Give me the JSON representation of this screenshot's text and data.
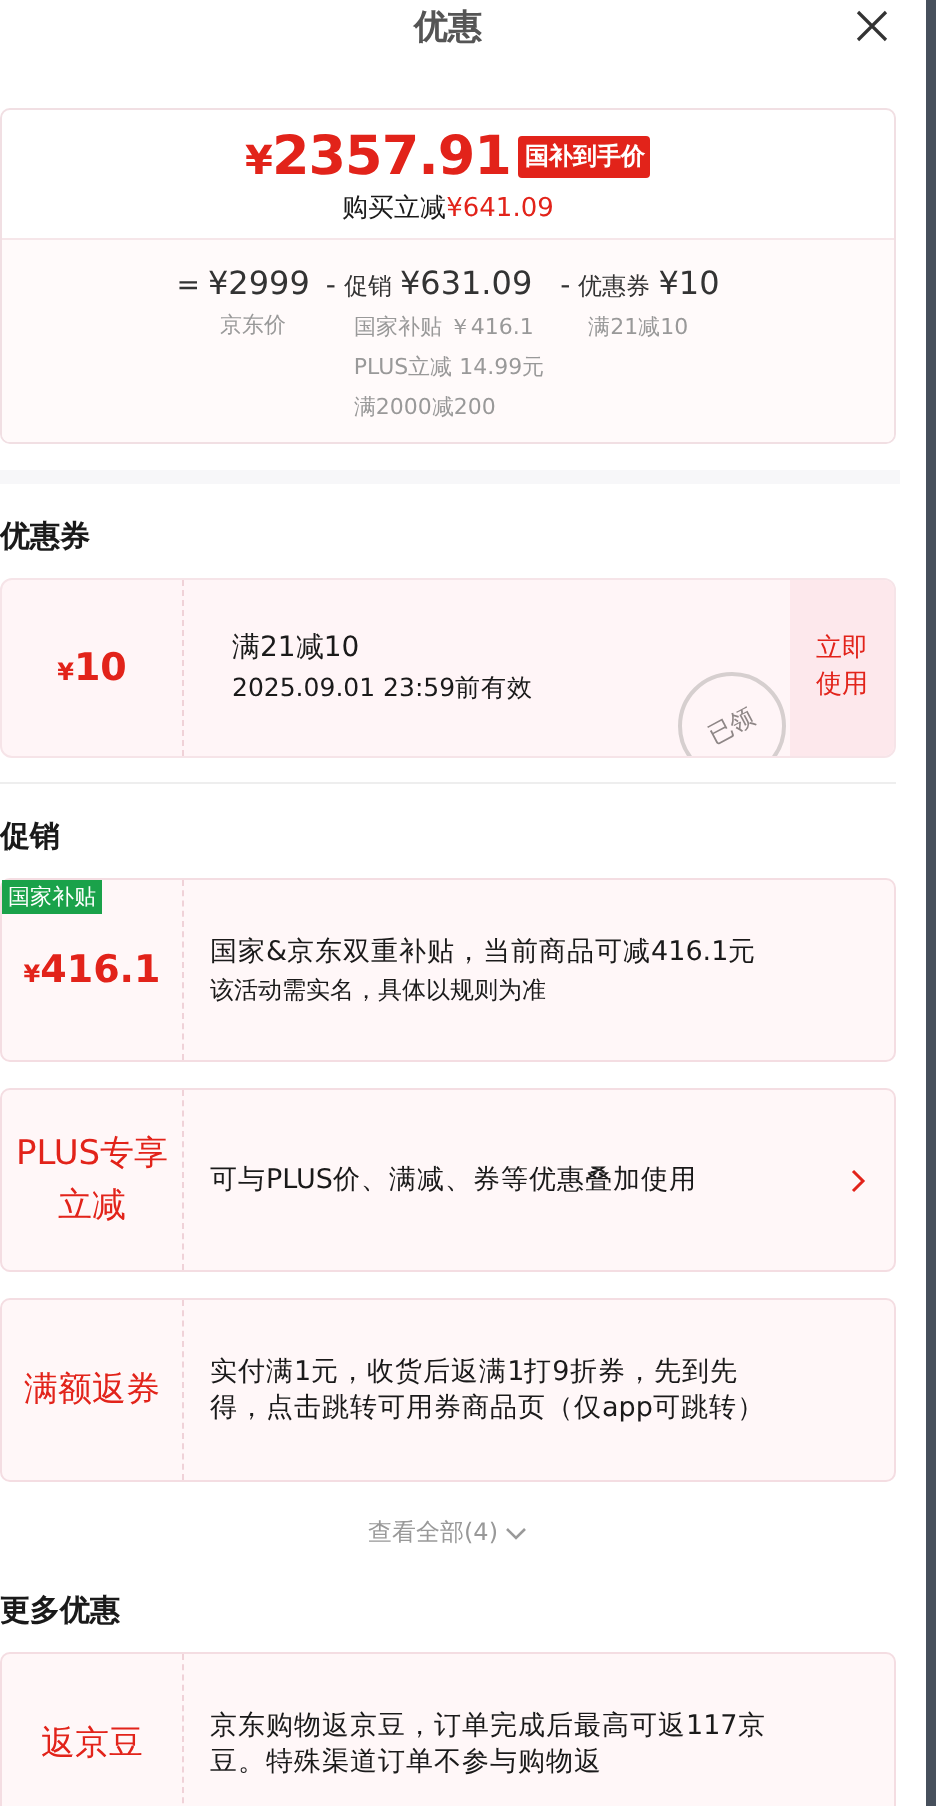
{
  "title": "优惠",
  "summary": {
    "currency": "¥",
    "price": "2357.91",
    "badge": "国补到手价",
    "saving_label": "购买立减",
    "saving": "¥641.09",
    "columns": [
      {
        "op": "=",
        "value": "¥2999",
        "notes": [
          "京东价"
        ]
      },
      {
        "op": "-",
        "label": "促销",
        "value": "¥631.09",
        "notes": [
          "国家补贴 ￥416.1",
          "PLUS立减 14.99元",
          "满2000减200"
        ]
      },
      {
        "op": "-",
        "label": "优惠券",
        "value": "¥10",
        "notes": [
          "满21减10"
        ]
      }
    ]
  },
  "coupons": {
    "title": "优惠券",
    "items": [
      {
        "currency": "¥",
        "amount": "10",
        "name": "满21减10",
        "expiry": "2025.09.01 23:59前有效",
        "stamp": "已领",
        "action": "立即使用"
      }
    ]
  },
  "promotions": {
    "title": "促销",
    "items": [
      {
        "kind": "amount",
        "tag": "国家补贴",
        "currency": "¥",
        "amount": "416.1",
        "text": "国家&京东双重补贴，当前商品可减416.1元",
        "note": "该活动需实名，具体以规则为准",
        "link": false
      },
      {
        "kind": "label",
        "label": "PLUS专享立减",
        "text": "可与PLUS价、满减、券等优惠叠加使用",
        "link": true
      },
      {
        "kind": "label",
        "label": "满额返券",
        "text": "实付满1元，收货后返满1打9折券，先到先得，点击跳转可用券商品页（仅app可跳转）",
        "link": false
      }
    ],
    "more": "查看全部(4)"
  },
  "more_offers": {
    "title": "更多优惠",
    "items": [
      {
        "kind": "label",
        "label": "返京豆",
        "text": "京东购物返京豆，订单完成后最高可返117京豆。特殊渠道订单不参与购物返",
        "link": false
      }
    ]
  }
}
